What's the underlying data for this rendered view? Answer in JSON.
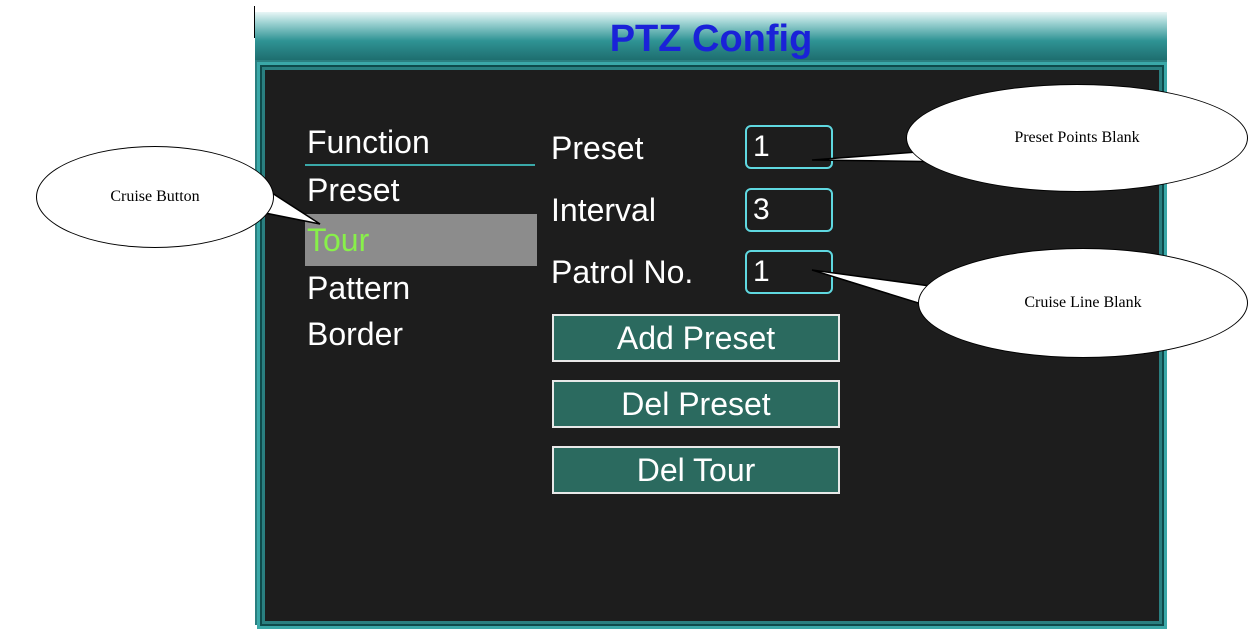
{
  "dialog": {
    "title": "PTZ Config",
    "menu": {
      "header": "Function",
      "items": [
        "Preset",
        "Tour",
        "Pattern",
        "Border"
      ],
      "selected": "Tour"
    },
    "fields": [
      {
        "label": "Preset",
        "value": "1"
      },
      {
        "label": "Interval",
        "value": "3"
      },
      {
        "label": "Patrol No.",
        "value": "1"
      }
    ],
    "buttons": [
      "Add Preset",
      "Del Preset",
      "Del Tour"
    ]
  },
  "callouts": {
    "cruise_button": "Cruise Button",
    "preset_points_blank": "Preset Points Blank",
    "cruise_line_blank": "Cruise Line Blank"
  },
  "colors": {
    "title_text": "#1a22d8",
    "selected_text": "#88f04a",
    "selected_bg": "#8c8c8c",
    "frame": "#2a7f80",
    "field_border": "#5fd8e0",
    "button_bg": "#2b6a5f"
  }
}
